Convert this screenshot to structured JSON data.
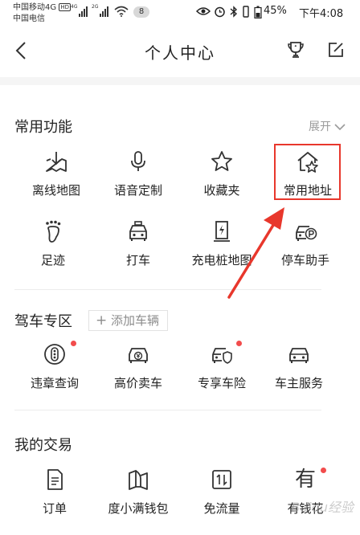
{
  "status_bar": {
    "carrier_1": "中国移动4G",
    "hd_badge": "HD",
    "carrier_2": "中国电信",
    "net_tag_1": "4G",
    "net_tag_2": "2G",
    "notification_count": "8",
    "battery": "45%",
    "time": "下午4:08"
  },
  "header": {
    "title": "个人中心"
  },
  "sections": {
    "common": {
      "title": "常用功能",
      "expand_label": "展开",
      "items": [
        {
          "label": "离线地图",
          "icon": "download-map-icon"
        },
        {
          "label": "语音定制",
          "icon": "microphone-icon"
        },
        {
          "label": "收藏夹",
          "icon": "star-icon"
        },
        {
          "label": "常用地址",
          "icon": "home-star-icon"
        },
        {
          "label": "足迹",
          "icon": "footprint-icon"
        },
        {
          "label": "打车",
          "icon": "taxi-icon"
        },
        {
          "label": "充电桩地图",
          "icon": "charging-pile-icon"
        },
        {
          "label": "停车助手",
          "icon": "parking-car-icon"
        }
      ]
    },
    "driving": {
      "title": "驾车专区",
      "add_car_label": "添加车辆",
      "items": [
        {
          "label": "违章查询",
          "icon": "traffic-light-icon"
        },
        {
          "label": "高价卖车",
          "icon": "car-yuan-icon"
        },
        {
          "label": "专享车险",
          "icon": "car-shield-icon"
        },
        {
          "label": "车主服务",
          "icon": "car-icon"
        }
      ]
    },
    "trade": {
      "title": "我的交易",
      "items": [
        {
          "label": "订单",
          "icon": "document-icon"
        },
        {
          "label": "度小满钱包",
          "icon": "wallet-book-icon"
        },
        {
          "label": "免流量",
          "icon": "data-transfer-icon"
        },
        {
          "label": "有钱花",
          "icon": "you-qian-hua-icon",
          "glyph": "有"
        }
      ]
    }
  },
  "watermark": "Baidu经验",
  "colors": {
    "highlight": "#e8372c",
    "badge_dot": "#f24c4c",
    "muted_text": "#9b9b9b"
  }
}
